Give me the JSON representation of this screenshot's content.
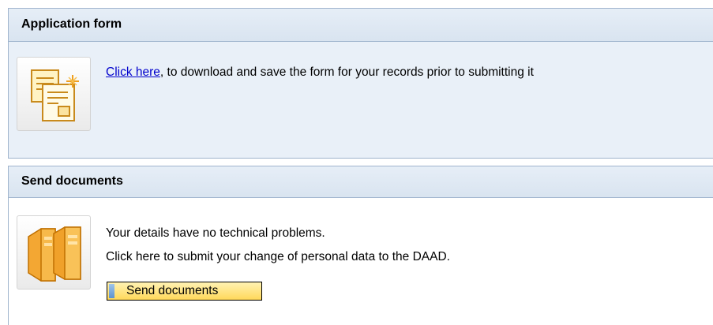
{
  "application_form": {
    "title": "Application form",
    "link_text": "Click here",
    "description": ", to download and save the form for your records prior to submitting it",
    "icon": "form-document-icon"
  },
  "send_documents": {
    "title": "Send documents",
    "status_text": "Your details have no technical problems.",
    "instruction_text": "Click here to submit your change of personal data to the DAAD.",
    "button_label": "Send documents",
    "icon": "server-cabinet-icon"
  },
  "colors": {
    "header_bg": "#d9e4f0",
    "panel_bg": "#e9f0f8",
    "border": "#9fb4cd",
    "link": "#0000cc",
    "button_bg": "#ffd85a"
  }
}
